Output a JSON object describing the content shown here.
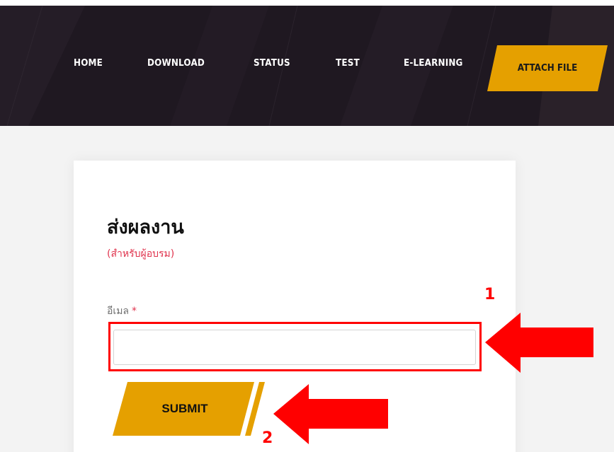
{
  "nav": {
    "items": [
      {
        "label": "HOME"
      },
      {
        "label": "DOWNLOAD"
      },
      {
        "label": "STATUS"
      },
      {
        "label": "TEST"
      },
      {
        "label": "E-LEARNING"
      },
      {
        "label": "ATTACH FILE",
        "active": true
      }
    ]
  },
  "form": {
    "title": "ส่งผลงาน",
    "subtitle": "(สำหรับผู้อบรม)",
    "email_label": "อีเมล",
    "required_mark": "*",
    "email_value": "",
    "submit_label": "SUBMIT"
  },
  "annotations": {
    "marker_1": "1",
    "marker_2": "2"
  },
  "colors": {
    "header_bg": "#1f1821",
    "accent_gold": "#e5a000",
    "required_red": "#e0334d",
    "annotation_red": "#ff0000"
  },
  "icons": [
    "arrow-left-icon",
    "arrow-left-icon"
  ]
}
